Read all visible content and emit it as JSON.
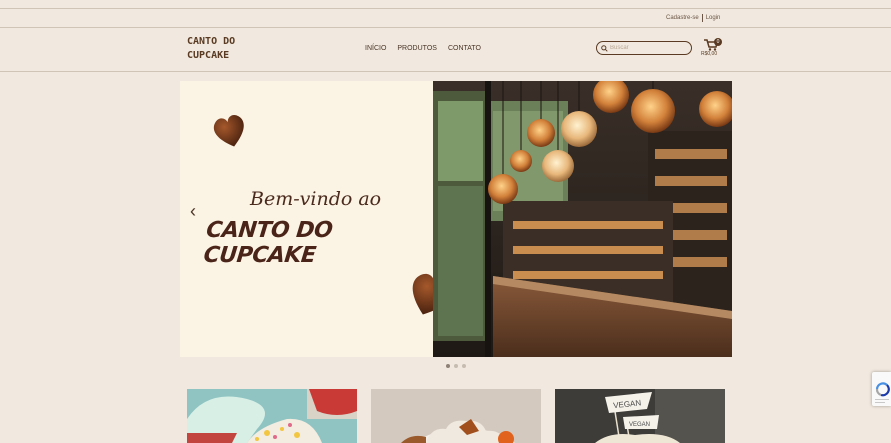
{
  "auth": {
    "signup": "Cadastre-se",
    "login": "Login"
  },
  "header": {
    "logo_line1": "CANTO DO",
    "logo_line2": "CUPCAKE",
    "nav": [
      "INÍCIO",
      "PRODUTOS",
      "CONTATO"
    ],
    "search_placeholder": "Buscar",
    "cart_count": "0",
    "cart_total": "R$0,00"
  },
  "hero": {
    "welcome": "Bem-vindo ao",
    "brand": "CANTO DO CUPCAKE",
    "prev_glyph": "‹",
    "slides": 3,
    "active_slide": 1
  },
  "cards": {
    "vegan_flag_1": "VEGAN",
    "vegan_flag_2": "VEGAN"
  },
  "colors": {
    "background": "#f1e9df",
    "brand_brown": "#5a3a22",
    "hero_cream": "#fbf3e4"
  }
}
